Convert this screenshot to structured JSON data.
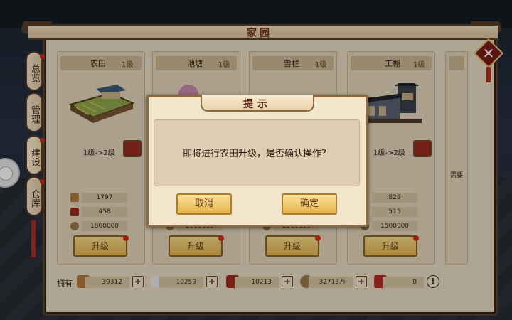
{
  "window": {
    "title": "家园"
  },
  "tabs": [
    {
      "label": "总览",
      "badge": true
    },
    {
      "label": "管理",
      "badge": false
    },
    {
      "label": "建设",
      "badge": true
    },
    {
      "label": "仓库",
      "badge": true
    }
  ],
  "cards": [
    {
      "name": "农田",
      "level": "1级",
      "upgrade": "1级->2级",
      "res": [
        "1797",
        "458",
        "1800000"
      ],
      "button": "升级"
    },
    {
      "name": "池塘",
      "level": "1级",
      "upgrade": "",
      "res": [
        "",
        "",
        "2000000"
      ],
      "button": "升级"
    },
    {
      "name": "兽栏",
      "level": "1级",
      "upgrade": "",
      "res": [
        "",
        "",
        "2300000"
      ],
      "button": "升级"
    },
    {
      "name": "工棚",
      "level": "1级",
      "upgrade": "1级->2级",
      "res": [
        "829",
        "515",
        "1500000"
      ],
      "button": "升级"
    },
    {
      "name": "",
      "level": "",
      "need": "需要",
      "button": ""
    }
  ],
  "bottom": {
    "own_label": "拥有",
    "wood": "39312",
    "silver": "10259",
    "meat": "10213",
    "coins": "32713万",
    "gift": "0"
  },
  "dialog": {
    "title": "提示",
    "message": "即将进行农田升级，是否确认操作？",
    "cancel": "取消",
    "confirm": "确定"
  },
  "colors": {
    "panel": "#e9dcc4",
    "frame": "#5a3d26",
    "button_gold": "#e6b24a",
    "accent_red": "#b52a1e"
  }
}
